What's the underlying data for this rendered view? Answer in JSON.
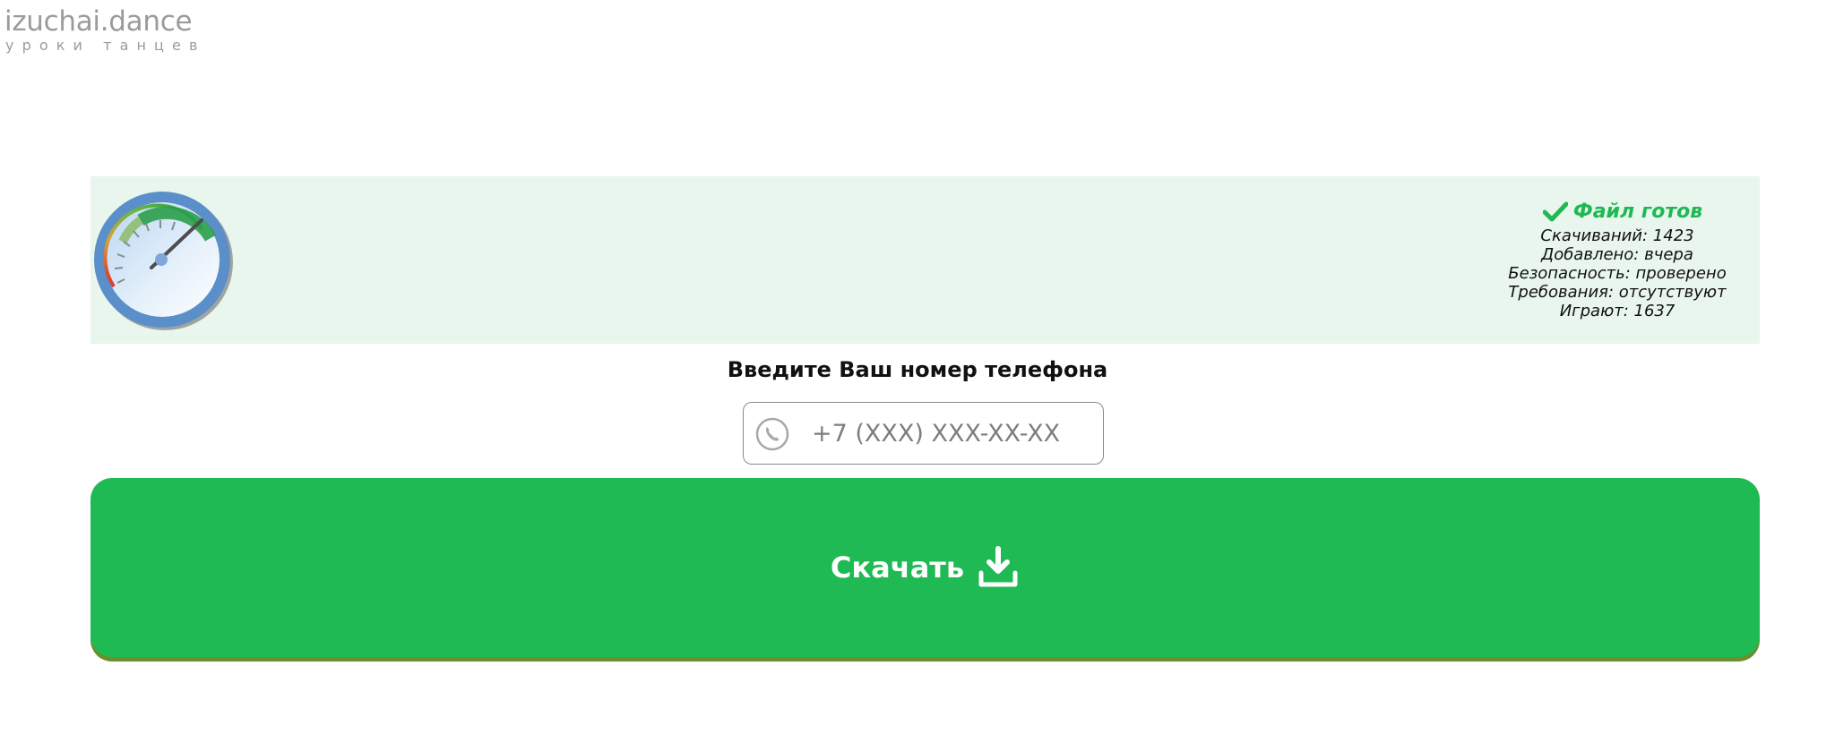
{
  "logo": {
    "title": "izuchai.dance",
    "subtitle": "уроки танцев"
  },
  "banner": {
    "gauge_icon": "speedometer-icon",
    "ready_icon": "checkmark-icon",
    "ready_text": "Файл готов",
    "stats": [
      "Скачиваний: 1423",
      "Добавлено: вчера",
      "Безопасность: проверено",
      "Требования: отсутствуют",
      "Играют: 1637"
    ]
  },
  "phone": {
    "prompt": "Введите Ваш номер телефона",
    "placeholder": "+7 (XXX) XXX-XX-XX",
    "icon": "phone-icon"
  },
  "download": {
    "label": "Скачать",
    "icon": "download-icon"
  },
  "colors": {
    "banner_bg": "#e8f6ee",
    "accent_green": "#1fb954",
    "button_green": "#20ba55",
    "button_shadow": "#6b8f2a",
    "logo_gray": "#9b9b9b"
  }
}
